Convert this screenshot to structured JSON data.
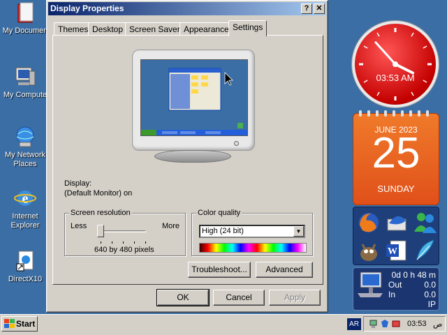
{
  "desktop": {
    "icons": [
      {
        "label": "My Documen"
      },
      {
        "label": "My Compute"
      },
      {
        "label": "My Network Places"
      },
      {
        "label": "Internet Explorer"
      },
      {
        "label": "DirectX10"
      }
    ]
  },
  "dialog": {
    "title": "Display Properties",
    "help_glyph": "?",
    "close_glyph": "✕",
    "tabs": [
      {
        "label": "Themes"
      },
      {
        "label": "Desktop"
      },
      {
        "label": "Screen Saver"
      },
      {
        "label": "Appearance"
      },
      {
        "label": "Settings",
        "active": true
      }
    ],
    "display_label": "Display:",
    "display_value": "(Default Monitor) on",
    "resolution": {
      "group_label": "Screen resolution",
      "less": "Less",
      "more": "More",
      "value_text": "640 by 480 pixels",
      "slider_position": 0
    },
    "color": {
      "group_label": "Color quality",
      "selected": "High (24 bit)"
    },
    "buttons": {
      "troubleshoot": "Troubleshoot...",
      "advanced": "Advanced",
      "ok": "OK",
      "cancel": "Cancel",
      "apply": "Apply"
    }
  },
  "gadgets": {
    "clock": {
      "time": "03:53 AM",
      "hour": 3,
      "minute": 53
    },
    "calendar": {
      "month_year": "JUNE 2023",
      "day": "25",
      "weekday": "SUNDAY"
    },
    "network": {
      "uptime": "0d 0 h 48 m",
      "out_label": "Out",
      "out_value": "0.0",
      "in_label": "In",
      "in_value": "0.0",
      "protocol": "IP"
    }
  },
  "taskbar": {
    "start_label": "Start",
    "language": "AR",
    "time": "03:53",
    "ampm": "ص"
  },
  "colors": {
    "desktop": "#3b6ea5",
    "dialog_face": "#d4d0c8",
    "title_active": "#0a246a",
    "clock_red": "#c40000",
    "calendar_orange": "#e0501a"
  }
}
